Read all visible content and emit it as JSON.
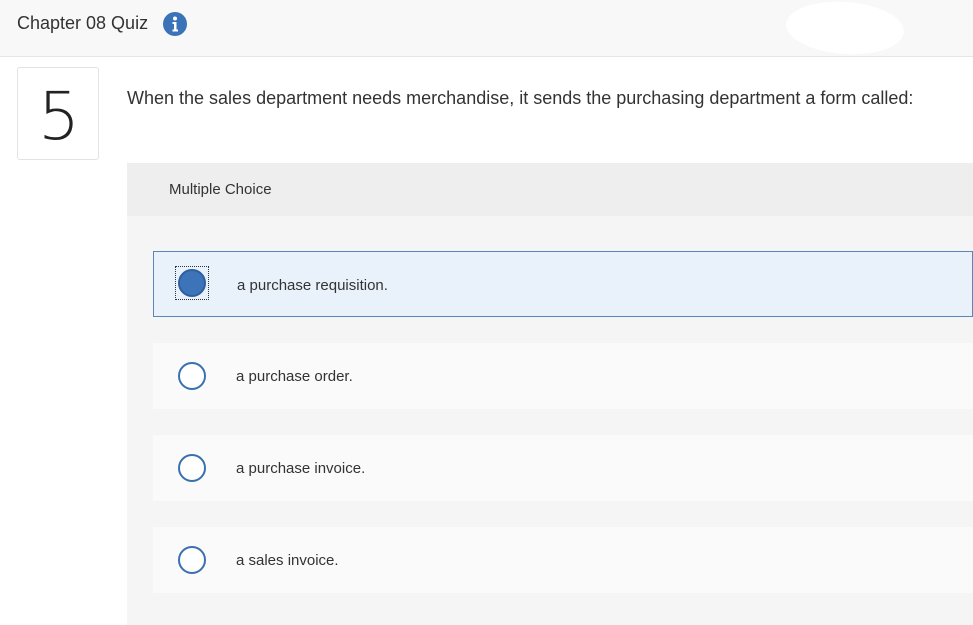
{
  "header": {
    "title": "Chapter 08 Quiz",
    "info_icon": "info-icon"
  },
  "question": {
    "number": "5",
    "text": "When the sales department needs merchandise, it sends the purchasing department a form called:",
    "type": "Multiple Choice"
  },
  "options": [
    {
      "label": "a purchase requisition.",
      "selected": true
    },
    {
      "label": "a purchase order.",
      "selected": false
    },
    {
      "label": "a purchase invoice.",
      "selected": false
    },
    {
      "label": "a sales invoice.",
      "selected": false
    }
  ],
  "colors": {
    "accent": "#3d73b9",
    "selected_bg": "#e9f1fb",
    "header_bg": "#f8f8f8"
  }
}
